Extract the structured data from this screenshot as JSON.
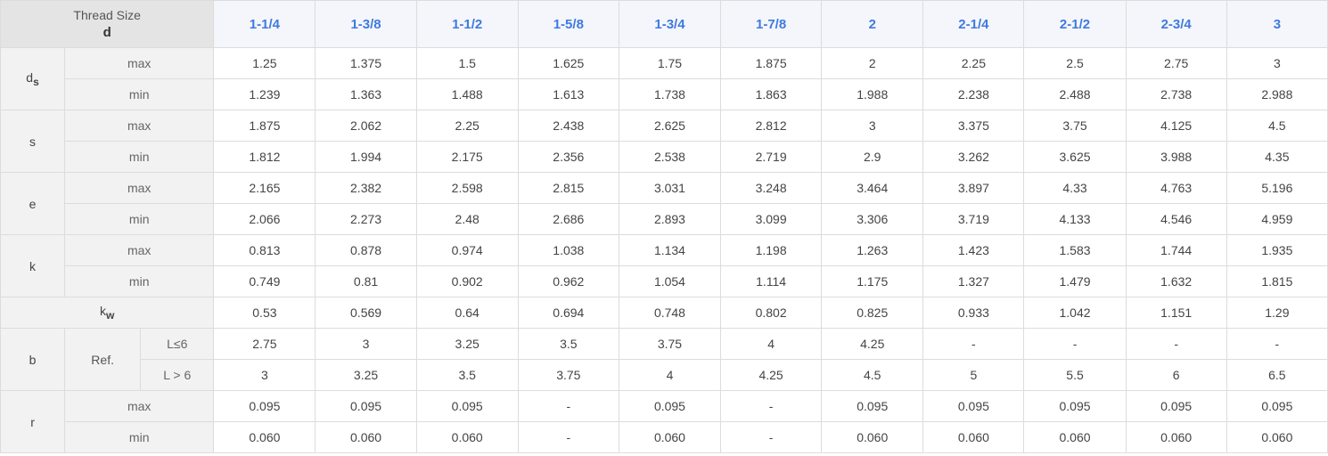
{
  "header": {
    "title_line1": "Thread Size",
    "title_line2": "d",
    "sizes": [
      "1-1/4",
      "1-3/8",
      "1-1/2",
      "1-5/8",
      "1-3/4",
      "1-7/8",
      "2",
      "2-1/4",
      "2-1/2",
      "2-3/4",
      "3"
    ]
  },
  "labels": {
    "max": "max",
    "min": "min",
    "ref": "Ref."
  },
  "params": {
    "ds": {
      "name": "d",
      "sub": "s"
    },
    "s": {
      "name": "s"
    },
    "e": {
      "name": "e"
    },
    "k": {
      "name": "k"
    },
    "kw": {
      "name": "k",
      "sub": "w"
    },
    "b": {
      "name": "b",
      "cond1": "L≤6",
      "cond2": "L > 6"
    },
    "r": {
      "name": "r"
    }
  },
  "rows": {
    "ds_max": [
      "1.25",
      "1.375",
      "1.5",
      "1.625",
      "1.75",
      "1.875",
      "2",
      "2.25",
      "2.5",
      "2.75",
      "3"
    ],
    "ds_min": [
      "1.239",
      "1.363",
      "1.488",
      "1.613",
      "1.738",
      "1.863",
      "1.988",
      "2.238",
      "2.488",
      "2.738",
      "2.988"
    ],
    "s_max": [
      "1.875",
      "2.062",
      "2.25",
      "2.438",
      "2.625",
      "2.812",
      "3",
      "3.375",
      "3.75",
      "4.125",
      "4.5"
    ],
    "s_min": [
      "1.812",
      "1.994",
      "2.175",
      "2.356",
      "2.538",
      "2.719",
      "2.9",
      "3.262",
      "3.625",
      "3.988",
      "4.35"
    ],
    "e_max": [
      "2.165",
      "2.382",
      "2.598",
      "2.815",
      "3.031",
      "3.248",
      "3.464",
      "3.897",
      "4.33",
      "4.763",
      "5.196"
    ],
    "e_min": [
      "2.066",
      "2.273",
      "2.48",
      "2.686",
      "2.893",
      "3.099",
      "3.306",
      "3.719",
      "4.133",
      "4.546",
      "4.959"
    ],
    "k_max": [
      "0.813",
      "0.878",
      "0.974",
      "1.038",
      "1.134",
      "1.198",
      "1.263",
      "1.423",
      "1.583",
      "1.744",
      "1.935"
    ],
    "k_min": [
      "0.749",
      "0.81",
      "0.902",
      "0.962",
      "1.054",
      "1.114",
      "1.175",
      "1.327",
      "1.479",
      "1.632",
      "1.815"
    ],
    "kw": [
      "0.53",
      "0.569",
      "0.64",
      "0.694",
      "0.748",
      "0.802",
      "0.825",
      "0.933",
      "1.042",
      "1.151",
      "1.29"
    ],
    "b_l1": [
      "2.75",
      "3",
      "3.25",
      "3.5",
      "3.75",
      "4",
      "4.25",
      "-",
      "-",
      "-",
      "-"
    ],
    "b_l2": [
      "3",
      "3.25",
      "3.5",
      "3.75",
      "4",
      "4.25",
      "4.5",
      "5",
      "5.5",
      "6",
      "6.5"
    ],
    "r_max": [
      "0.095",
      "0.095",
      "0.095",
      "-",
      "0.095",
      "-",
      "0.095",
      "0.095",
      "0.095",
      "0.095",
      "0.095"
    ],
    "r_min": [
      "0.060",
      "0.060",
      "0.060",
      "-",
      "0.060",
      "-",
      "0.060",
      "0.060",
      "0.060",
      "0.060",
      "0.060"
    ]
  }
}
